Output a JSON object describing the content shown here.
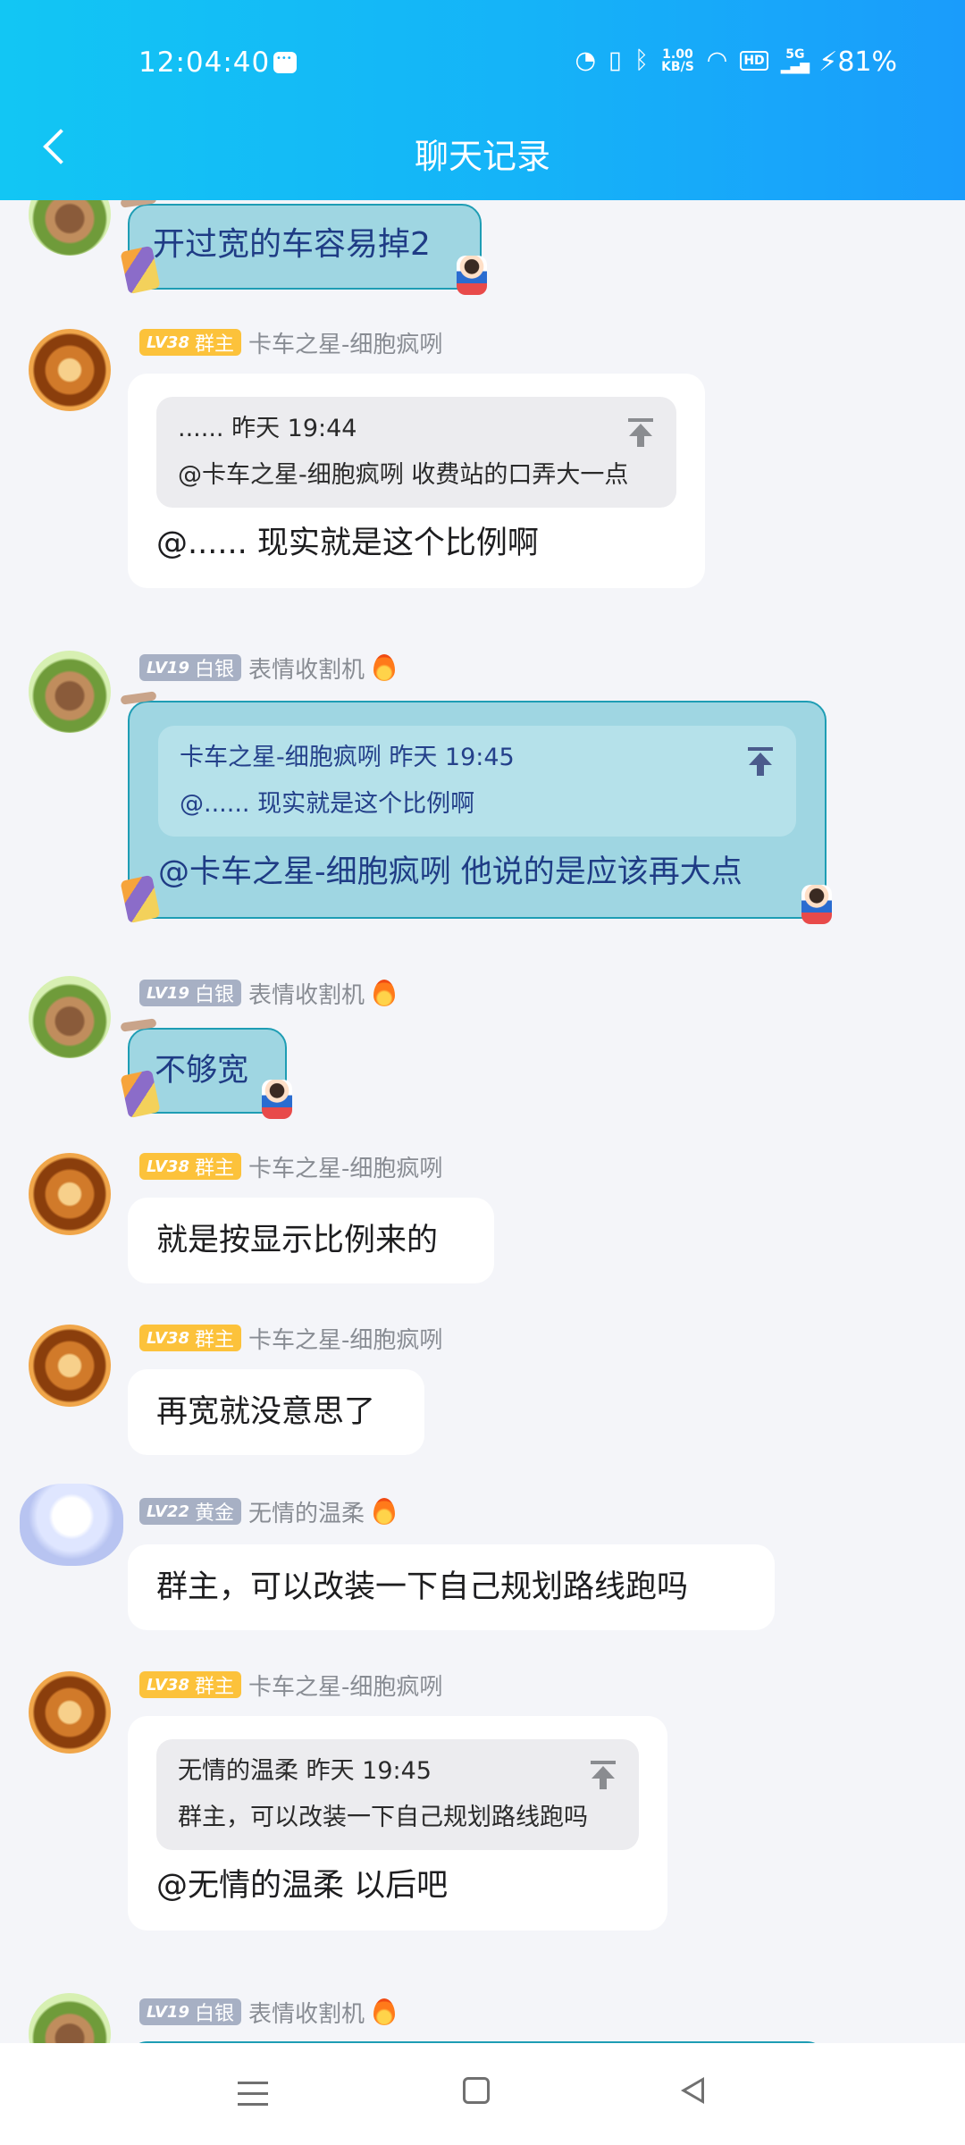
{
  "status_bar": {
    "time": "12:04:40",
    "net_speed_top": "1.00",
    "net_speed_unit": "KB/S",
    "hd": "HD",
    "signal": "5G",
    "battery": "81%"
  },
  "header": {
    "title": "聊天记录"
  },
  "messages": [
    {
      "text": "开过宽的车容易掉2"
    },
    {
      "level": "LV38",
      "badge": "群主",
      "name": "卡车之星-细胞疯咧",
      "quote_head": "...... 昨天 19:44",
      "quote_body": "@卡车之星-细胞疯咧 收费站的口弄大一点",
      "text": "@...... 现实就是这个比例啊"
    },
    {
      "level": "LV19",
      "badge": "白银",
      "name": "表情收割机",
      "quote_head": "卡车之星-细胞疯咧 昨天 19:45",
      "quote_body": "@...... 现实就是这个比例啊",
      "text": "@卡车之星-细胞疯咧 他说的是应该再大点"
    },
    {
      "level": "LV19",
      "badge": "白银",
      "name": "表情收割机",
      "text": "不够宽"
    },
    {
      "level": "LV38",
      "badge": "群主",
      "name": "卡车之星-细胞疯咧",
      "text": "就是按显示比例来的"
    },
    {
      "level": "LV38",
      "badge": "群主",
      "name": "卡车之星-细胞疯咧",
      "text": "再宽就没意思了"
    },
    {
      "level": "LV22",
      "badge": "黄金",
      "name": "无情的温柔",
      "text": "群主，可以改装一下自己规划路线跑吗"
    },
    {
      "level": "LV38",
      "badge": "群主",
      "name": "卡车之星-细胞疯咧",
      "quote_head": "无情的温柔 昨天 19:45",
      "quote_body": "群主，可以改装一下自己规划路线跑吗",
      "text": "@无情的温柔 以后吧"
    },
    {
      "level": "LV19",
      "badge": "白银",
      "name": "表情收割机"
    }
  ],
  "colors": {
    "header_gradient_start": "#12c6f4",
    "header_gradient_end": "#1a9cfb",
    "teal_bubble": "#9fd6e2",
    "owner_badge": "#fcc23b",
    "silver_badge": "#a7b0c4"
  }
}
